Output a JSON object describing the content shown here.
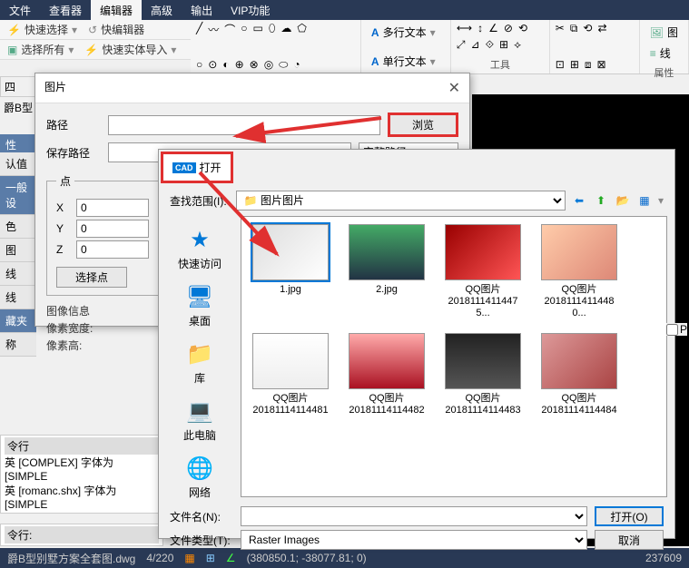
{
  "menubar": {
    "tabs": [
      "文件",
      "查看器",
      "编辑器",
      "高级",
      "输出",
      "VIP功能"
    ],
    "active_index": 2
  },
  "quickbar": {
    "quick_select": "快速选择",
    "select_all": "选择所有",
    "quick_editor": "快编辑器",
    "quick_entity_import": "快速实体导入"
  },
  "ribbon": {
    "multiline_text": "多行文本",
    "singleline_text": "单行文本",
    "image_btn": "图",
    "line_btn": "线",
    "tools_label": "工具",
    "properties_label": "属性"
  },
  "left_tabs": [
    "认值",
    "一般设",
    "色",
    "图",
    "线",
    "线",
    "藏夹",
    "称"
  ],
  "left_heading": "性",
  "left_extra": "爵B型",
  "dlg_image": {
    "title": "图片",
    "path_label": "路径",
    "save_path_label": "保存路径",
    "browse_btn": "浏览",
    "full_path_option": "完整路径",
    "point_legend": "点",
    "x_label": "X",
    "y_label": "Y",
    "z_label": "Z",
    "x_val": "0",
    "y_val": "0",
    "z_val": "0",
    "select_point_btn": "选择点",
    "info_title": "图像信息",
    "pixel_width": "像素宽度:",
    "pixel_height": "像素高:"
  },
  "dlg_open": {
    "title": "打开",
    "cad_badge": "CAD",
    "lookup_label": "查找范围(I):",
    "lookup_value": "图片",
    "places": [
      {
        "icon": "★",
        "label": "快速访问",
        "color": "#0078d7"
      },
      {
        "icon": "🖥",
        "label": "桌面",
        "color": "#0078d7"
      },
      {
        "icon": "📁",
        "label": "库",
        "color": "#f5b400"
      },
      {
        "icon": "💻",
        "label": "此电脑",
        "color": "#0078d7"
      },
      {
        "icon": "🌐",
        "label": "网络",
        "color": "#0078d7"
      }
    ],
    "files": [
      {
        "name": "1.jpg",
        "cls": "th1",
        "sel": true
      },
      {
        "name": "2.jpg",
        "cls": "th2"
      },
      {
        "name": "QQ图片20181114114751.jpg",
        "display": "QQ图片\n20181114114475...",
        "cls": "th3"
      },
      {
        "name": "QQ图片20181114114800.jpg",
        "display": "QQ图片\n20181114114480...",
        "cls": "th4"
      },
      {
        "name": "QQ图片20181114114481.jpg",
        "display": "QQ图片\n20181114114481",
        "cls": "th5"
      },
      {
        "name": "QQ图片20181114114482.jpg",
        "display": "QQ图片\n20181114114482",
        "cls": "th6"
      },
      {
        "name": "QQ图片20181114114483.jpg",
        "display": "QQ图片\n20181114114483",
        "cls": "th7"
      },
      {
        "name": "QQ图片20181114114484.jpg",
        "display": "QQ图片\n20181114114484",
        "cls": "th8"
      }
    ],
    "filename_label": "文件名(N):",
    "filetype_label": "文件类型(T):",
    "filetype_value": "Raster Images",
    "open_btn": "打开(O)",
    "cancel_btn": "取消"
  },
  "cmd": {
    "heading": "令行",
    "line1": "英 [COMPLEX] 字体为 [SIMPLE",
    "line2": "英 [romanc.shx] 字体为 [SIMPLE",
    "prompt": "令行:"
  },
  "status": {
    "file": "爵B型别墅方案全套图.dwg",
    "pages": "4/220",
    "coords": "(380850.1; -38077.81; 0)",
    "right_num": "237609"
  },
  "preview_checkbox": "P",
  "nav_icons": [
    "⬅",
    "⬆",
    "📂",
    "▦"
  ]
}
